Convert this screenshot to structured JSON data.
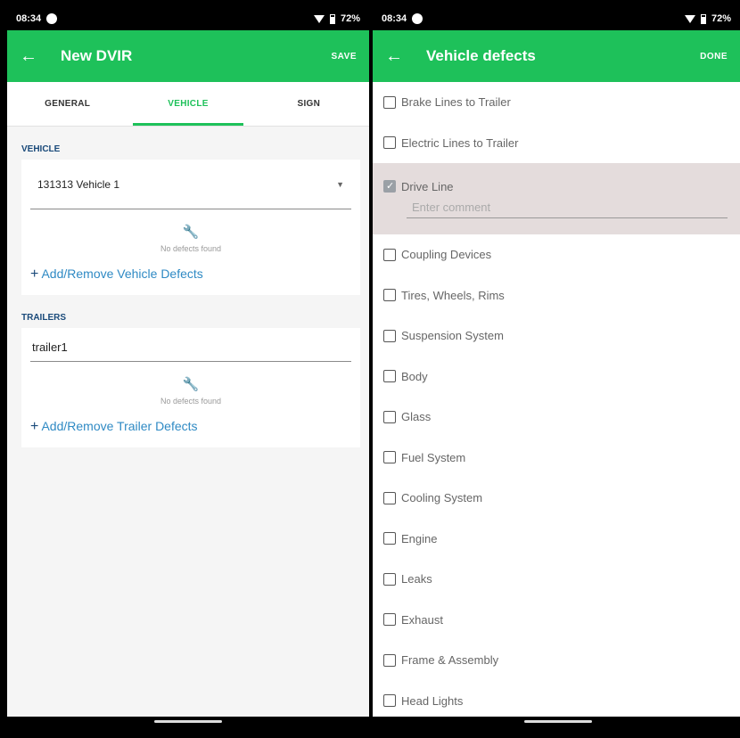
{
  "status_left": {
    "time": "08:34",
    "battery": "72%"
  },
  "status_right": {
    "time": "08:34",
    "battery": "72%"
  },
  "dvir": {
    "title": "New DVIR",
    "back_icon": "arrow-left-icon",
    "save_label": "SAVE",
    "tabs": [
      {
        "label": "GENERAL",
        "active": false
      },
      {
        "label": "VEHICLE",
        "active": true
      },
      {
        "label": "SIGN",
        "active": false
      }
    ],
    "vehicle": {
      "section_label": "VEHICLE",
      "selected": "131313 Vehicle 1",
      "empty_text": "No defects found",
      "add_label": "Add/Remove Vehicle Defects"
    },
    "trailers": {
      "section_label": "TRAILERS",
      "value": "trailer1",
      "empty_text": "No defects found",
      "add_label": "Add/Remove Trailer Defects"
    }
  },
  "defects_screen": {
    "title": "Vehicle defects",
    "done_label": "DONE",
    "comment_placeholder": "Enter comment",
    "items": [
      {
        "label": "Brake Lines to Trailer",
        "checked": false
      },
      {
        "label": "Electric Lines to Trailer",
        "checked": false
      },
      {
        "label": "Drive Line",
        "checked": true
      },
      {
        "label": "Coupling Devices",
        "checked": false
      },
      {
        "label": "Tires, Wheels, Rims",
        "checked": false
      },
      {
        "label": "Suspension System",
        "checked": false
      },
      {
        "label": "Body",
        "checked": false
      },
      {
        "label": "Glass",
        "checked": false
      },
      {
        "label": "Fuel System",
        "checked": false
      },
      {
        "label": "Cooling System",
        "checked": false
      },
      {
        "label": "Engine",
        "checked": false
      },
      {
        "label": "Leaks",
        "checked": false
      },
      {
        "label": "Exhaust",
        "checked": false
      },
      {
        "label": "Frame & Assembly",
        "checked": false
      },
      {
        "label": "Head Lights",
        "checked": false
      }
    ]
  },
  "colors": {
    "accent": "#1ec15a",
    "link": "#2f8ac4",
    "section": "#1a4a7a"
  }
}
